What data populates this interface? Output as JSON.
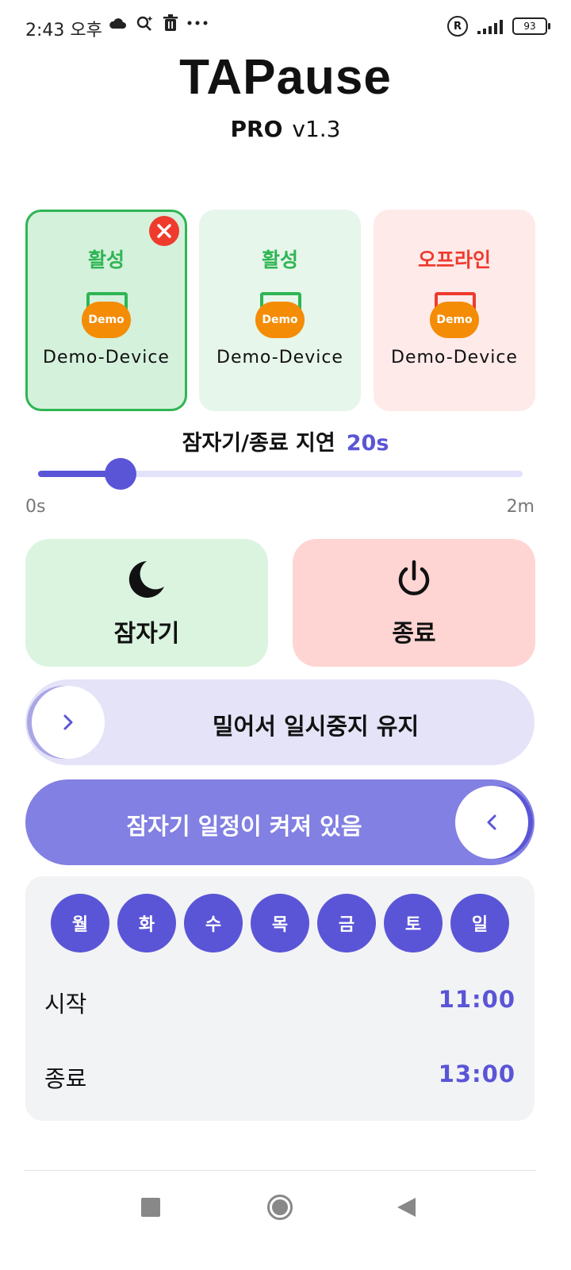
{
  "status_bar": {
    "time": "2:43 오후",
    "icons": [
      "cloud-icon",
      "search-sparkle-icon",
      "trash-icon",
      "more-dots-icon"
    ],
    "right_icons": [
      "registered-icon",
      "signal-icon",
      "battery-icon"
    ],
    "battery": "93"
  },
  "header": {
    "title": "TAPause",
    "edition": "PRO",
    "version": "v1.3"
  },
  "devices": [
    {
      "status": "활성",
      "name": "Demo-Device",
      "badge": "Demo",
      "state": "active-selected",
      "status_color": "#2fb554"
    },
    {
      "status": "활성",
      "name": "Demo-Device",
      "badge": "Demo",
      "state": "active",
      "status_color": "#2fb554"
    },
    {
      "status": "오프라인",
      "name": "Demo-Device",
      "badge": "Demo",
      "state": "offline",
      "status_color": "#ef3b2d"
    }
  ],
  "delay": {
    "label": "잠자기/종료 지연",
    "value": "20s",
    "min_label": "0s",
    "max_label": "2m",
    "level": 0.17
  },
  "actions": {
    "sleep_label": "잠자기",
    "shutdown_label": "종료"
  },
  "swipe": {
    "text": "밀어서 일시중지 유지"
  },
  "schedule": {
    "toggle_text": "잠자기 일정이 켜져 있음",
    "days": [
      "월",
      "화",
      "수",
      "목",
      "금",
      "토",
      "일"
    ],
    "start_label": "시작",
    "start_time": "11:00",
    "end_label": "종료",
    "end_time": "13:00"
  },
  "colors": {
    "accent": "#5a55d6",
    "active_green": "#2fb554",
    "offline_red": "#ef3b2d",
    "device_orange": "#f48c06"
  }
}
